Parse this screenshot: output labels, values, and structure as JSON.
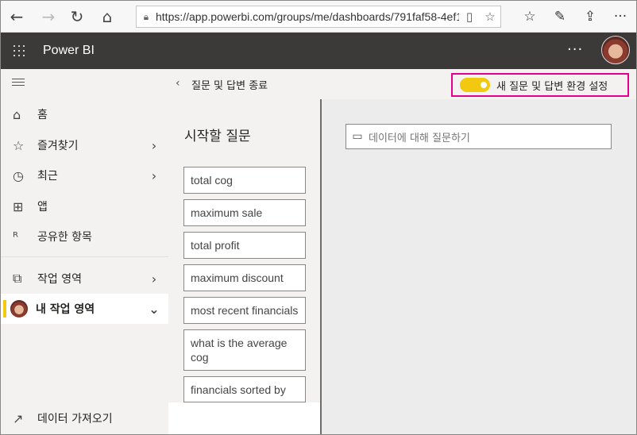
{
  "browser": {
    "url": "https://app.powerbi.com/groups/me/dashboards/791faf58-4ef1-",
    "icons": [
      "back-icon",
      "forward-icon",
      "refresh-icon",
      "home-icon",
      "lock-icon",
      "reader-icon",
      "favorite-star-icon",
      "favorites-list-icon",
      "pen-icon",
      "share-icon"
    ]
  },
  "header": {
    "brand": "Power BI",
    "more": "···"
  },
  "sidebar": {
    "items": [
      {
        "label": "홈",
        "icon": "⌂"
      },
      {
        "label": "즐겨찾기",
        "icon": "☆"
      },
      {
        "label": "최근",
        "icon": "◷"
      },
      {
        "label": "앱",
        "icon": "⊞"
      },
      {
        "label": "공유한 항목",
        "icon": "ᴿ"
      },
      {
        "label": "작업 영역",
        "icon": "⧉"
      },
      {
        "label": "내 작업 영역",
        "icon": ""
      },
      {
        "label": "데이터 가져오기",
        "icon": "↗"
      }
    ]
  },
  "qa": {
    "exit_label": "질문 및 답변 종료",
    "toggle_label": "새 질문 및 답변 환경 설정",
    "toggle_on": true,
    "starting_title": "시작할 질문",
    "questions": [
      "total cog",
      "maximum sale",
      "total profit",
      "maximum discount",
      "most recent financials",
      "what is the average cog",
      "financials sorted by"
    ],
    "input_placeholder": "데이터에 대해 질문하기"
  },
  "colors": {
    "accent_yellow": "#f2c811",
    "highlight_magenta": "#e3008c",
    "header_dark": "#3b3a39"
  }
}
